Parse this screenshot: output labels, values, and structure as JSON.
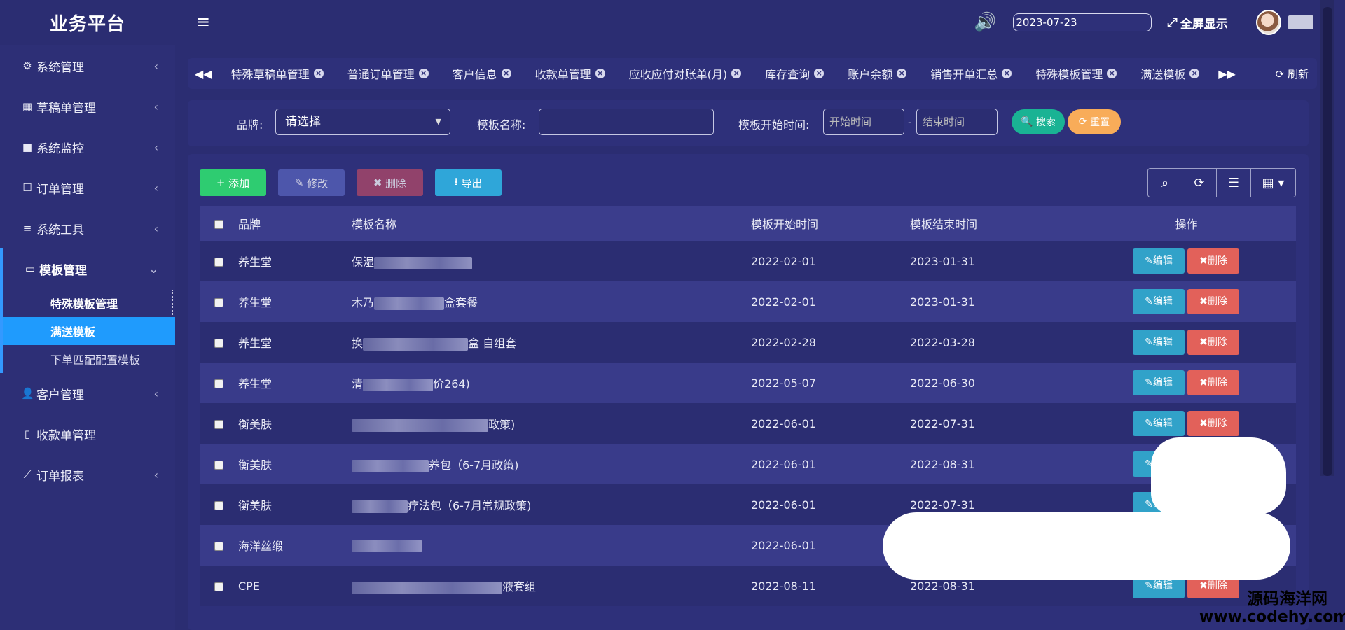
{
  "app": {
    "title": "业务平台",
    "date": "2023-07-23",
    "fullscreen": "全屏显示"
  },
  "sidebar": {
    "items": [
      {
        "label": "系统管理",
        "icon": "gear-icon"
      },
      {
        "label": "草稿单管理",
        "icon": "calendar-icon"
      },
      {
        "label": "系统监控",
        "icon": "video-camera-icon"
      },
      {
        "label": "订单管理",
        "icon": "edit-icon"
      },
      {
        "label": "系统工具",
        "icon": "bars-icon"
      },
      {
        "label": "模板管理",
        "icon": "window-icon"
      },
      {
        "label": "客户管理",
        "icon": "user-icon"
      },
      {
        "label": "收款单管理",
        "icon": "tablet-icon"
      },
      {
        "label": "订单报表",
        "icon": "line-chart-icon"
      }
    ],
    "sub_items": [
      "特殊模板管理",
      "满送模板",
      "下单匹配配置模板"
    ]
  },
  "tabs": [
    "特殊草稿单管理",
    "普通订单管理",
    "客户信息",
    "收款单管理",
    "应收应付对账单(月)",
    "库存查询",
    "账户余额",
    "销售开单汇总",
    "特殊模板管理",
    "满送模板"
  ],
  "tabs_refresh": "刷新",
  "search": {
    "brand_label": "品牌:",
    "brand_value": "请选择",
    "name_label": "模板名称:",
    "time_label": "模板开始时间:",
    "start_placeholder": "开始时间",
    "end_placeholder": "结束时间",
    "range_sep": "-",
    "search_btn": "搜索",
    "reset_btn": "重置"
  },
  "toolbar": {
    "add": "添加",
    "edit": "修改",
    "delete": "删除",
    "export": "导出"
  },
  "table": {
    "headers": [
      "品牌",
      "模板名称",
      "模板开始时间",
      "模板结束时间",
      "操作"
    ],
    "edit_label": "编辑",
    "delete_label": "删除",
    "rows": [
      {
        "brand": "养生堂",
        "name_pre": "保湿",
        "name_post": "",
        "start": "2022-02-01",
        "end": "2023-01-31"
      },
      {
        "brand": "养生堂",
        "name_pre": "木乃",
        "name_post": "盒套餐",
        "start": "2022-02-01",
        "end": "2023-01-31"
      },
      {
        "brand": "养生堂",
        "name_pre": "换",
        "name_post": "盒 自组套",
        "start": "2022-02-28",
        "end": "2022-03-28"
      },
      {
        "brand": "养生堂",
        "name_pre": "清",
        "name_post": "价264)",
        "start": "2022-05-07",
        "end": "2022-06-30"
      },
      {
        "brand": "衡美肤",
        "name_pre": "",
        "name_post": "政策)",
        "start": "2022-06-01",
        "end": "2022-07-31"
      },
      {
        "brand": "衡美肤",
        "name_pre": "",
        "name_post": "养包（6-7月政策)",
        "start": "2022-06-01",
        "end": "2022-08-31"
      },
      {
        "brand": "衡美肤",
        "name_pre": "",
        "name_post": "疗法包（6-7月常规政策)",
        "start": "2022-06-01",
        "end": "2022-07-31"
      },
      {
        "brand": "海洋丝缎",
        "name_pre": "",
        "name_post": "",
        "start": "2022-06-01",
        "end": ""
      },
      {
        "brand": "CPE",
        "name_pre": "",
        "name_post": "液套组",
        "start": "2022-08-11",
        "end": "2022-08-31"
      }
    ]
  },
  "watermark": {
    "line1": "源码海洋网",
    "line2": "www.codehy.com"
  }
}
